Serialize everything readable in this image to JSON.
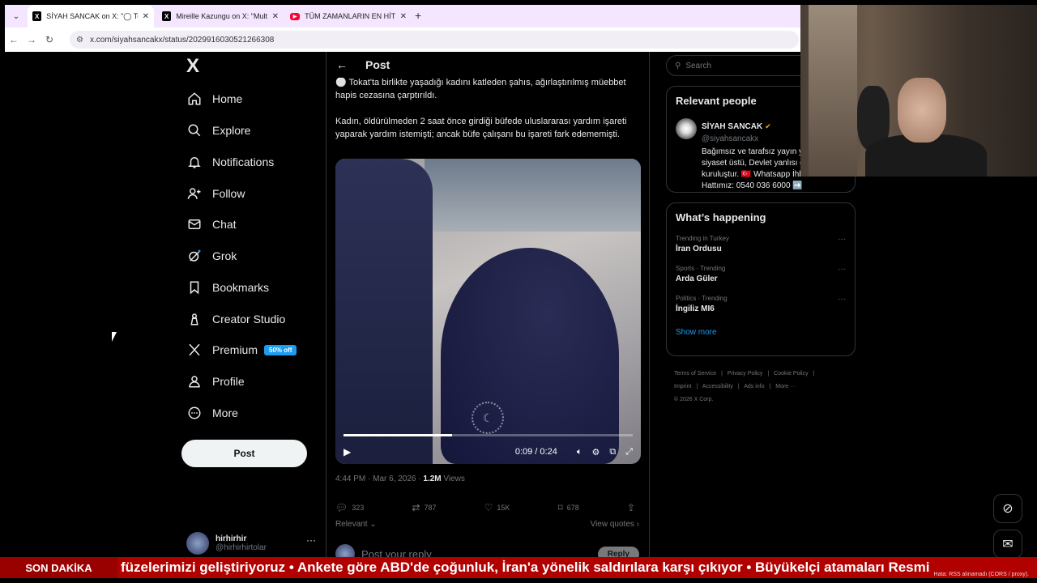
{
  "browser": {
    "tabs": [
      {
        "title": "SİYAH SANCAK on X: \"◯ Tokat",
        "favicon": "x-logo",
        "active": true
      },
      {
        "title": "Mireille Kazungu on X: \"Multifu",
        "favicon": "x-logo",
        "active": false
      },
      {
        "title": "TÜM ZAMANLARIN EN HİT ŞAR",
        "favicon": "youtube-logo",
        "active": false
      }
    ],
    "url": "x.com/siyahsancakx/status/2029916030521266308"
  },
  "sidebar": {
    "logo": "X",
    "items": [
      {
        "label": "Home",
        "icon": "home-icon"
      },
      {
        "label": "Explore",
        "icon": "search-icon"
      },
      {
        "label": "Notifications",
        "icon": "bell-icon"
      },
      {
        "label": "Follow",
        "icon": "person-add-icon"
      },
      {
        "label": "Chat",
        "icon": "mail-icon"
      },
      {
        "label": "Grok",
        "icon": "grok-icon"
      },
      {
        "label": "Bookmarks",
        "icon": "bookmark-icon"
      },
      {
        "label": "Creator Studio",
        "icon": "creator-icon"
      },
      {
        "label": "Premium",
        "icon": "x-icon",
        "badge": "50% off"
      },
      {
        "label": "Profile",
        "icon": "person-icon"
      },
      {
        "label": "More",
        "icon": "more-circle-icon"
      }
    ],
    "post_button": "Post",
    "account": {
      "name": "hirhirhir",
      "handle": "@hirhirhirtolar"
    }
  },
  "main": {
    "title": "Post",
    "text_paragraphs": [
      "⚪ Tokat'ta birlikte yaşadığı kadını katleden şahıs, ağırlaştırılmış müebbet hapis cezasına çarptırıldı.",
      "Kadın, öldürülmeden 2 saat önce girdiği büfede uluslararası yardım işareti yaparak yardım istemişti; ancak büfe çalışanı bu işareti fark edememişti."
    ],
    "video": {
      "time": "0:09 / 0:24",
      "progress": 0.375
    },
    "meta": {
      "time": "4:44 PM · Mar 6, 2026 · ",
      "views": "1.2M",
      "views_label": " Views"
    },
    "actions": {
      "replies": "323",
      "reposts": "787",
      "likes": "15K",
      "bookmarks": "678"
    },
    "sort_label": "Relevant ⌄",
    "view_quotes": "View quotes ›",
    "reply_placeholder": "Post your reply",
    "reply_button": "Reply"
  },
  "right": {
    "search_placeholder": "Search",
    "relevant_people": {
      "title": "Relevant people",
      "name": "SİYAH SANCAK",
      "handle": "@siyahsancakx",
      "bio": "Bağımsız ve tarafsız yayın yapan siyaset üstü, Devlet yanlısı olarak kuruluştur. 🇹🇷 Whatsapp İhbar Hattımız: 0540 036 6000 ➡️"
    },
    "happening": {
      "title": "What’s happening",
      "trends": [
        {
          "context": "Trending in Turkey",
          "title": "İran Ordusu"
        },
        {
          "context": "Sports · Trending",
          "title": "Arda Güler"
        },
        {
          "context": "Politics · Trending",
          "title": "İngiliz MI6"
        }
      ],
      "show_more": "Show more"
    },
    "footer": [
      "Terms of Service",
      "|",
      "Privacy Policy",
      "|",
      "Cookie Policy",
      "|",
      "Imprint",
      "|",
      "Accessibility",
      "|",
      "Ads info",
      "|",
      "More ···",
      "© 2026 X Corp."
    ]
  },
  "ticker": {
    "label": "SON DAKİKA",
    "text": "füzelerimizi geliştiriyoruz  •  Ankete göre ABD'de çoğunluk, İran'a yönelik saldırılara karşı çıkıyor  •  Büyükelçi atamaları Resmi",
    "error": "Hata: RSS alınamadı (CORS / proxy)."
  },
  "colors": {
    "accent": "#1d9bf0",
    "ticker": "#b00000",
    "tabstrip": "#f5e6ff"
  }
}
